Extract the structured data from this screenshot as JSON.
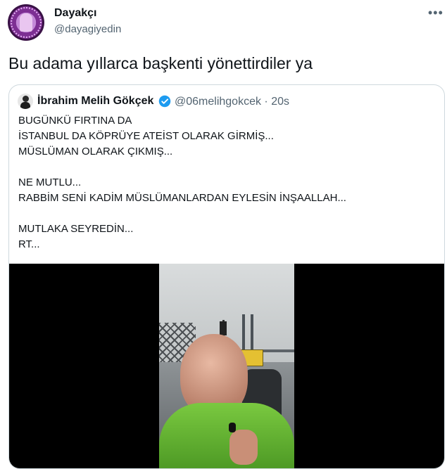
{
  "author": {
    "display_name": "Dayakçı",
    "handle": "@dayagiyedin"
  },
  "tweet": {
    "text": "Bu adama yıllarca başkenti yönettirdiler ya"
  },
  "more_icon": "more-horizontal-icon",
  "quoted": {
    "display_name": "İbrahim Melih Gökçek",
    "verified_icon": "verified-badge-icon",
    "handle_time": "@06melihgokcek · 20s",
    "lines": [
      "BUGÜNKÜ FIRTINA DA",
      "İSTANBUL DA KÖPRÜYE ATEİST OLARAK GİRMİŞ...",
      "MÜSLÜMAN OLARAK ÇIKMIŞ...",
      "NE MUTLU...",
      "RABBİM SENİ KADİM MÜSLÜMANLARDAN EYLESİN İNŞAALLAH...",
      "MUTLAKA SEYREDİN...",
      "RT..."
    ]
  },
  "colors": {
    "text": "#0f1419",
    "secondary": "#536471",
    "border": "#cfd9de",
    "verified": "#1d9bf0"
  }
}
